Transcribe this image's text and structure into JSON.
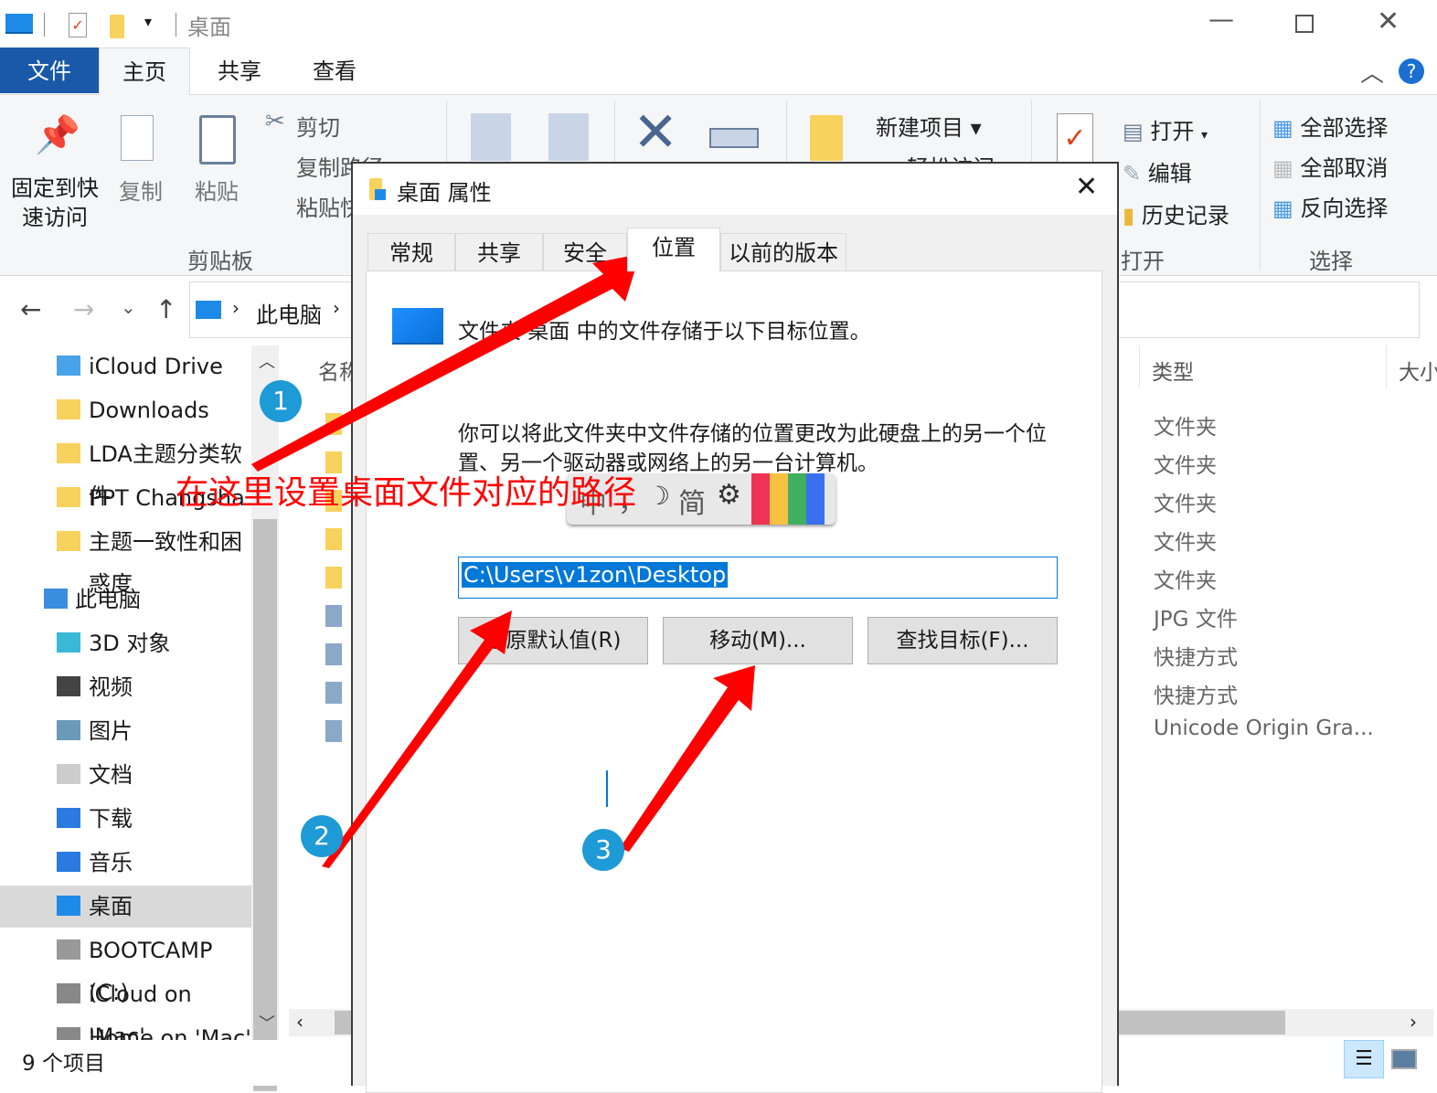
{
  "window": {
    "title": "桌面"
  },
  "ribbon_tabs": {
    "file": "文件",
    "home": "主页",
    "share": "共享",
    "view": "查看"
  },
  "ribbon": {
    "pin": "固定到快\n速访问",
    "pin_l1": "固定到快",
    "pin_l2": "速访问",
    "copy": "复制",
    "paste": "粘贴",
    "cut": "剪切",
    "copy_path": "复制路径",
    "paste_shortcut": "粘贴快捷方式",
    "clipboard_group": "剪贴板",
    "new_item": "新建项目",
    "easy_access": "轻松访问",
    "open": "打开",
    "edit": "编辑",
    "history": "历史记录",
    "open_group": "打开",
    "select_all": "全部选择",
    "select_none": "全部取消",
    "invert_selection": "反向选择",
    "select_group": "选择"
  },
  "address": {
    "crumb": "此电脑"
  },
  "nav_pane": {
    "items": [
      {
        "label": "iCloud Drive",
        "icon": "icloud-folder-icon"
      },
      {
        "label": "Downloads",
        "icon": "folder-icon"
      },
      {
        "label": "LDA主题分类软件",
        "icon": "folder-icon"
      },
      {
        "label": "PPT Changsha",
        "icon": "folder-icon"
      },
      {
        "label": "主题一致性和困惑度",
        "icon": "folder-icon"
      },
      {
        "label": "此电脑",
        "icon": "computer-icon"
      },
      {
        "label": "3D 对象",
        "icon": "cube-icon"
      },
      {
        "label": "视频",
        "icon": "video-icon"
      },
      {
        "label": "图片",
        "icon": "pictures-icon"
      },
      {
        "label": "文档",
        "icon": "documents-icon"
      },
      {
        "label": "下载",
        "icon": "download-icon"
      },
      {
        "label": "音乐",
        "icon": "music-icon"
      },
      {
        "label": "桌面",
        "icon": "desktop-icon",
        "selected": true
      },
      {
        "label": "BOOTCAMP (C:)",
        "icon": "drive-icon"
      },
      {
        "label": "iCloud on 'Mac'",
        "icon": "network-drive-icon"
      },
      {
        "label": "Home on 'Mac'",
        "icon": "network-drive-icon"
      }
    ]
  },
  "file_list": {
    "col_name": "名称",
    "col_type": "类型",
    "col_size": "大小",
    "types": [
      "文件夹",
      "文件夹",
      "文件夹",
      "文件夹",
      "文件夹",
      "JPG 文件",
      "快捷方式",
      "快捷方式",
      "Unicode Origin Gra..."
    ]
  },
  "status": {
    "count": "9 个项目"
  },
  "dialog": {
    "title": "桌面 属性",
    "tabs": [
      "常规",
      "共享",
      "安全",
      "位置",
      "以前的版本"
    ],
    "active_tab": "位置",
    "intro": "文件夹 桌面 中的文件存储于以下目标位置。",
    "desc": "你可以将此文件夹中文件存储的位置更改为此硬盘上的另一个位置、另一个驱动器或网络上的另一台计算机。",
    "path": "C:\\Users\\v1zon\\Desktop",
    "restore_btn": "还原默认值(R)",
    "move_btn": "移动(M)...",
    "find_btn": "查找目标(F)..."
  },
  "annotations": {
    "note": "在这里设置桌面文件对应的路径",
    "steps": [
      "1",
      "2",
      "3"
    ],
    "accent": "#ff0000",
    "circle": "#1e9ad6"
  },
  "ime": {
    "mode": "中",
    "punct": "，",
    "moon": "☽",
    "script": "简",
    "gear": "⚙"
  }
}
